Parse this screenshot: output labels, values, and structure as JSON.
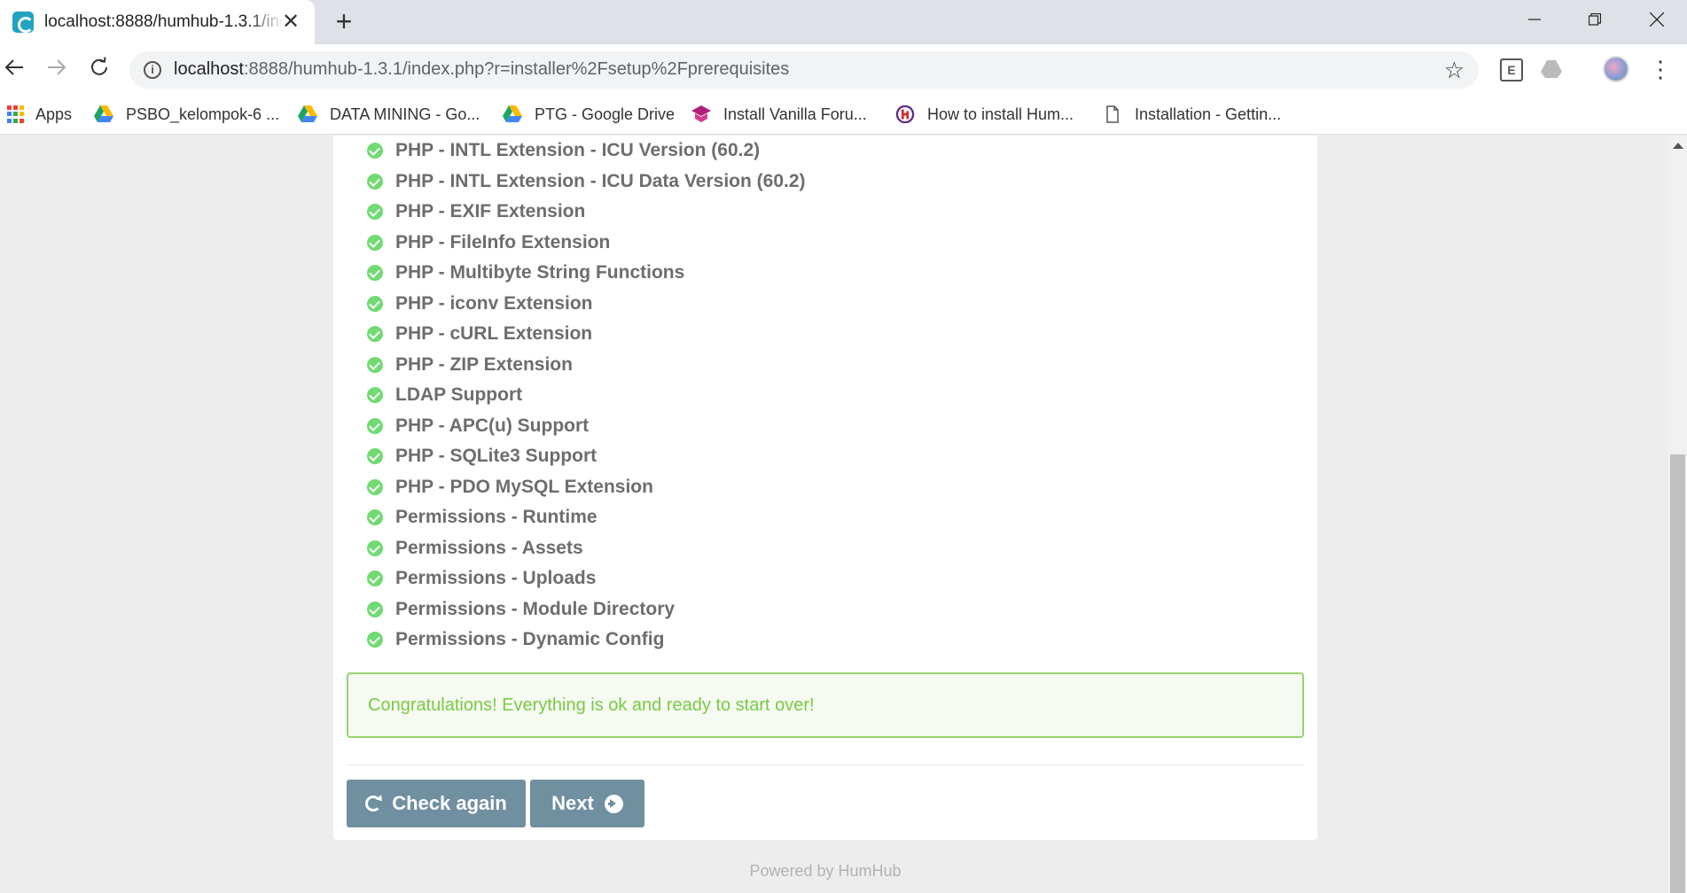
{
  "browser": {
    "tab_title": "localhost:8888/humhub-1.3.1/index.php?r=installer%2Fsetup%2Fprerequisites",
    "url_host": "localhost",
    "url_rest": ":8888/humhub-1.3.1/index.php?r=installer%2Fsetup%2Fprerequisites",
    "bookmarks": [
      {
        "label": "Apps",
        "icon": "apps-icon"
      },
      {
        "label": "PSBO_kelompok-6 ...",
        "icon": "google-drive-icon"
      },
      {
        "label": "DATA MINING - Go...",
        "icon": "google-drive-icon"
      },
      {
        "label": "PTG - Google Drive",
        "icon": "google-drive-icon"
      },
      {
        "label": "Install Vanilla Foru...",
        "icon": "vanilla-icon"
      },
      {
        "label": "How to install Hum...",
        "icon": "humhub-icon"
      },
      {
        "label": "Installation - Gettin...",
        "icon": "document-icon"
      }
    ]
  },
  "prerequisites": [
    "PHP - INTL Extension - ICU Version (60.2)",
    "PHP - INTL Extension - ICU Data Version (60.2)",
    "PHP - EXIF Extension",
    "PHP - FileInfo Extension",
    "PHP - Multibyte String Functions",
    "PHP - iconv Extension",
    "PHP - cURL Extension",
    "PHP - ZIP Extension",
    "LDAP Support",
    "PHP - APC(u) Support",
    "PHP - SQLite3 Support",
    "PHP - PDO MySQL Extension",
    "Permissions - Runtime",
    "Permissions - Assets",
    "Permissions - Uploads",
    "Permissions - Module Directory",
    "Permissions - Dynamic Config"
  ],
  "alert": {
    "text": "Congratulations! Everything is ok and ready to start over!"
  },
  "buttons": {
    "check_again": "Check again",
    "next": "Next"
  },
  "footer": {
    "text": "Powered by HumHub"
  },
  "colors": {
    "success": "#6fdb72",
    "button": "#708fa0",
    "alert_text": "#79ca43"
  }
}
